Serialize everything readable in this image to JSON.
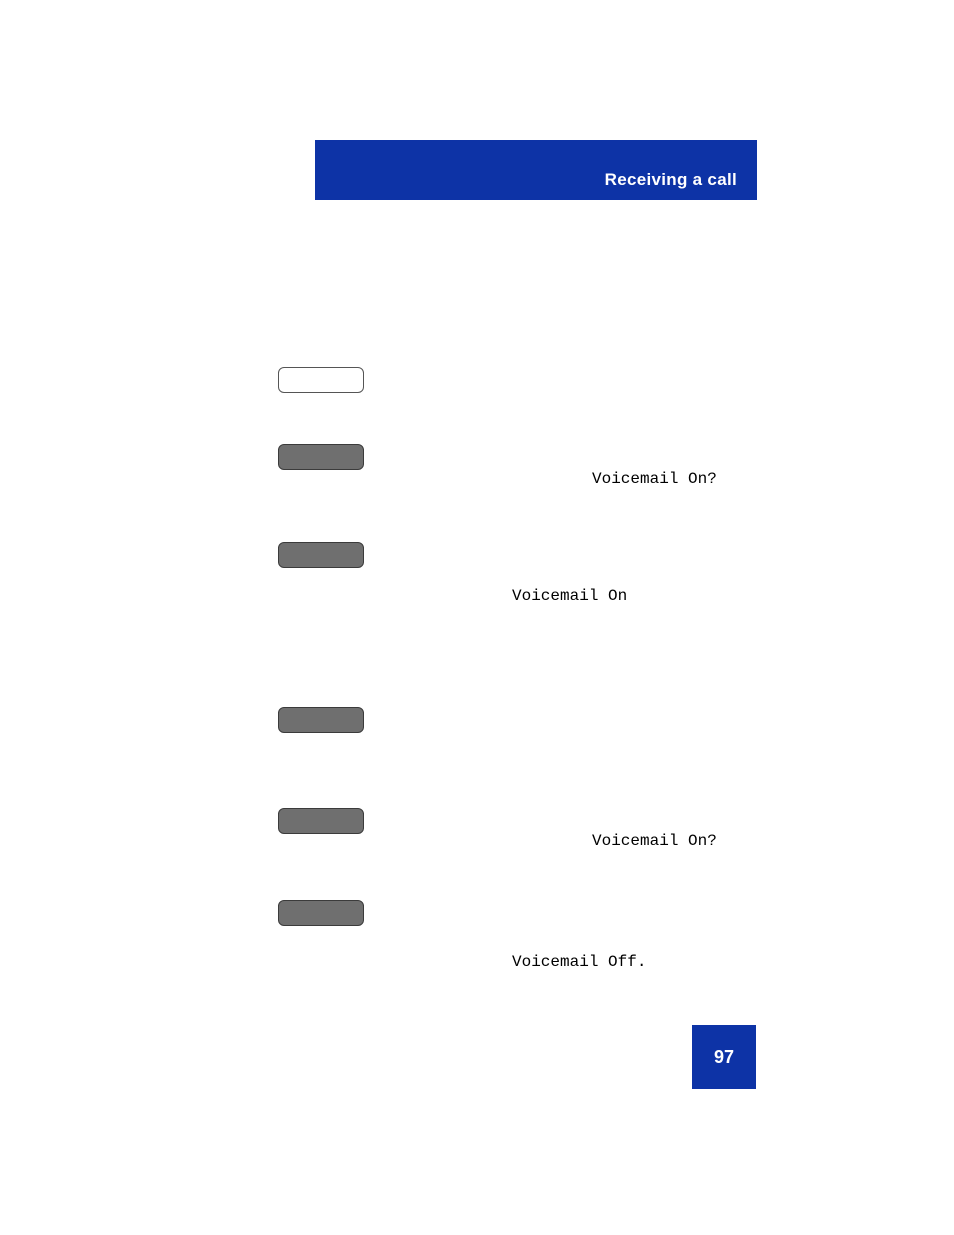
{
  "header": {
    "title": "Receiving a call"
  },
  "codeTexts": {
    "t1": "Voicemail On?",
    "t2": "Voicemail On",
    "t3": "Voicemail On?",
    "t4": "Voicemail Off."
  },
  "pageNumber": "97"
}
